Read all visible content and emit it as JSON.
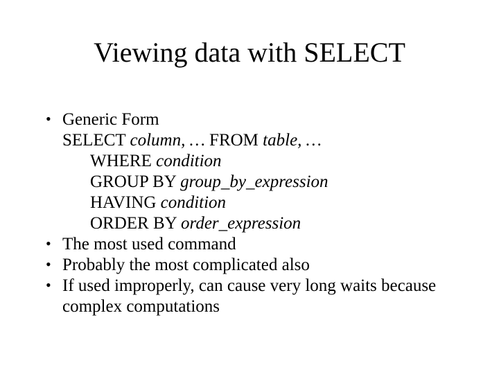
{
  "title": "Viewing data with SELECT",
  "bullets": {
    "b1": {
      "l1": {
        "pre": "Generic Form"
      },
      "l2": {
        "kw": "SELECT ",
        "it": "column, …",
        "mid": " FROM ",
        "it2": "table, …"
      },
      "l3": {
        "kw": "WHERE ",
        "it": "condition"
      },
      "l4": {
        "kw": "GROUP BY ",
        "it": "group_by_expression"
      },
      "l5": {
        "kw": "HAVING ",
        "it": "condition"
      },
      "l6": {
        "kw": "ORDER BY ",
        "it": "order_expression"
      }
    },
    "b2": "The most used command",
    "b3": "Probably the most complicated also",
    "b4": "If used improperly, can cause very long waits because complex computations"
  }
}
